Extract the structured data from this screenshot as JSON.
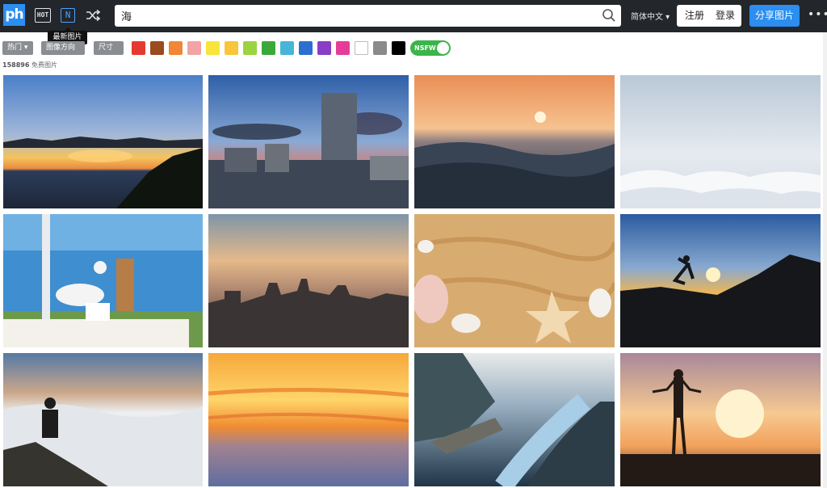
{
  "header": {
    "logo_text": "ph",
    "hot_icon_text": "HOT",
    "new_icon_text": "N",
    "search": {
      "value": "海",
      "placeholder": ""
    },
    "language": "简体中文 ▾",
    "register_label": "注册",
    "login_label": "登录",
    "share_label": "分享图片",
    "more_label": "•••",
    "tooltip": "最新图片"
  },
  "filters": {
    "hot": "热门 ▾",
    "orientation": "图像方向 ▾",
    "size": "尺寸 ▾",
    "nsfw": "NSFW",
    "colors": [
      "#e53a2f",
      "#9a4b1f",
      "#f18736",
      "#f2a3a3",
      "#f7e53b",
      "#f9c53b",
      "#9bd341",
      "#3ca83a",
      "#46b5d8",
      "#2d6fd0",
      "#8a3dc5",
      "#e53c99",
      "#ffffff",
      "#8a8a8a",
      "#000000"
    ]
  },
  "results": {
    "count": "158896",
    "label": "免费图片"
  },
  "images": [
    {
      "name": "sunset-lake"
    },
    {
      "name": "city-tower-clouds"
    },
    {
      "name": "ocean-wave-sunset"
    },
    {
      "name": "sea-of-clouds"
    },
    {
      "name": "seagull-table"
    },
    {
      "name": "city-skyline"
    },
    {
      "name": "seashells-sand"
    },
    {
      "name": "jumping-silhouette"
    },
    {
      "name": "man-above-clouds"
    },
    {
      "name": "orange-sky-clouds"
    },
    {
      "name": "fjord-cliff"
    },
    {
      "name": "woman-sunset-pier"
    }
  ]
}
